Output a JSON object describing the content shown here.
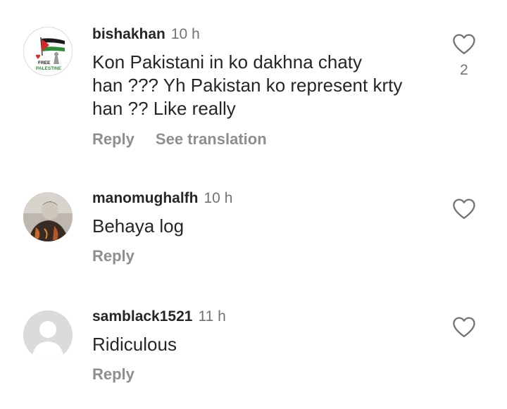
{
  "comments": [
    {
      "username": "bishakhan",
      "time": "10 h",
      "lines": [
        "Kon Pakistani in ko dakhna chaty",
        "han ??? Yh Pakistan ko represent krty",
        "han ?? Like really"
      ],
      "reply_label": "Reply",
      "translation_label": "See translation",
      "like_count": "2",
      "avatar": {
        "icon": "palestine-flag-icon",
        "lines": [
          "FREE",
          "PALESTINE"
        ]
      }
    },
    {
      "username": "manomughalfh",
      "time": "10 h",
      "lines": [
        "Behaya log"
      ],
      "reply_label": "Reply",
      "avatar": {
        "icon": "profile-photo"
      }
    },
    {
      "username": "samblack1521",
      "time": "11 h",
      "lines": [
        "Ridiculous"
      ],
      "reply_label": "Reply",
      "avatar": {
        "icon": "default-user-icon"
      }
    }
  ],
  "colors": {
    "text": "#262626",
    "secondary": "#737373",
    "action": "#8e8e8e",
    "placeholder_avatar": "#dbdbdb"
  }
}
